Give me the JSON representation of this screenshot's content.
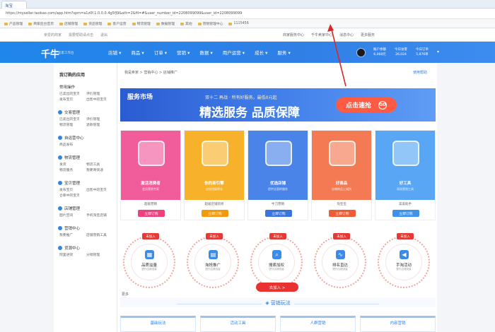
{
  "browser": {
    "tab_label": "淘宝",
    "url": "https://myseller.taobao.com/app.htm?spm=a1z0f.1.0.0.0.4g5fJ9&ath=2&fil=#&user_number_id=2208099099&user_id=2208099099",
    "bookmarks": [
      "产品管理",
      "商家后台首页",
      "店铺管理",
      "货品管理",
      "客户运营",
      "物流管理",
      "数据管理",
      "其他",
      "营销管理中心",
      "1115456"
    ]
  },
  "site_top": {
    "left_links": [
      "亲爱的商家",
      "需要帮助请点击",
      "退出"
    ],
    "right_links": [
      "商家服务中心",
      "千牛卖家中心",
      "消息中心",
      "更多服务"
    ]
  },
  "nav": {
    "logo": "千牛",
    "logo_sub": "卖家工作台",
    "menu": [
      "店铺",
      "商品",
      "订单",
      "营销",
      "数据",
      "用户运营",
      "成长",
      "服务"
    ],
    "stats": [
      {
        "label": "账户余额",
        "value": "6,068元"
      },
      {
        "label": "今日访客",
        "value": "26,024"
      },
      {
        "label": "今日订单",
        "value": "5,876单"
      }
    ]
  },
  "sidebar": {
    "title": "我订购的应用",
    "common_label": "常用操作",
    "common_items": [
      "已卖出的宝贝",
      "评价管理",
      "发布宝贝",
      "出售中的宝贝"
    ],
    "sections": [
      {
        "name": "交易管理",
        "items": [
          "已卖出的宝贝",
          "评价管理",
          "物流管理",
          "退款管理"
        ]
      },
      {
        "name": "自运营中心",
        "items": [
          "商品发布"
        ]
      },
      {
        "name": "物流管理",
        "items": [
          "发货",
          "物流工具",
          "物流服务",
          "我要寄快递"
        ]
      },
      {
        "name": "宝贝管理",
        "items": [
          "发布宝贝",
          "出售中的宝贝",
          "仓库中的宝贝"
        ]
      },
      {
        "name": "店铺管理",
        "items": [
          "图片空间",
          "手机淘宝店铺"
        ]
      },
      {
        "name": "营销中心",
        "items": [
          "我要推广",
          "店铺营销工具"
        ]
      },
      {
        "name": "货源中心",
        "items": [
          "阿里进货",
          "分销管理"
        ]
      }
    ]
  },
  "main": {
    "breadcrumb": "我是卖家 > 营销中心 > 店铺推广",
    "help_link": "使用帮助",
    "banner": {
      "logo": "服务市场",
      "top_text": "双十二 再战 · 所有好服务，最低0元起",
      "headline": "精选服务 品质保障",
      "button": "点击速抢"
    },
    "cards": [
      {
        "slogan": "激活消费者",
        "sub": "会员营销专家",
        "brand": "超级营销",
        "button": "立即订购",
        "color": "#f15c9a",
        "btn_color": "#ef3f7e"
      },
      {
        "slogan": "你的新引擎",
        "sub": "店铺流量增长",
        "brand": "超级店铺装修",
        "button": "立即订购",
        "color": "#f7b12a",
        "btn_color": "#f29a0c"
      },
      {
        "slogan": "优选店铺",
        "sub": "提供全面的服务",
        "brand": "牛刀营销",
        "button": "立即订购",
        "color": "#4a84e8",
        "btn_color": "#3b74dd"
      },
      {
        "slogan": "好商品",
        "sub": "店铺商品上架快",
        "brand": "淘宝宝",
        "button": "立即订购",
        "color": "#f37a52",
        "btn_color": "#ee5b34"
      },
      {
        "slogan": "好工具",
        "sub": "高效营销工具",
        "brand": "美美助手",
        "button": "立即订购",
        "color": "#58a6f4",
        "btn_color": "#3f92ec"
      }
    ],
    "circles": [
      {
        "badge": "未加入",
        "label": "品质溢量",
        "sub": "提升店铺流量"
      },
      {
        "badge": "未加入",
        "label": "淘抢推广",
        "sub": "提升店铺流量"
      },
      {
        "badge": "未加入",
        "label": "搜索加权",
        "sub": "提升店铺流量"
      },
      {
        "badge": "未加入",
        "label": "排名直达",
        "sub": "提升店铺流量"
      },
      {
        "badge": "未加入",
        "label": "手淘活动",
        "sub": "提升店铺流量"
      }
    ],
    "join_button": "去加入 >",
    "more_label": "更多",
    "section_title": "营销玩法",
    "section_tabs": [
      "基础玩法",
      "活动工具",
      "人群营销",
      "内容营销"
    ]
  },
  "colors": {
    "brand_blue": "#2f7fe6",
    "arrow_red": "#d42a2a"
  }
}
